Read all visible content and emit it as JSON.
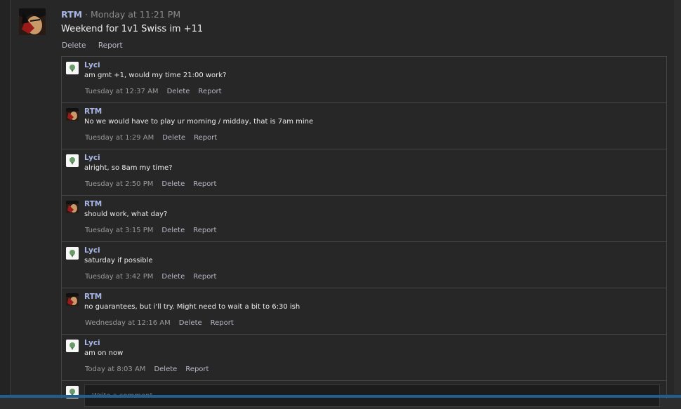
{
  "post": {
    "author": "RTM",
    "time": " · Monday at 11:21 PM",
    "body": "Weekend for 1v1 Swiss im +11",
    "delete_label": "Delete",
    "report_label": "Report"
  },
  "replies": [
    {
      "author": "Lyci",
      "text": "am gmt +1, would my time 21:00 work?",
      "time": "Tuesday at 12:37 AM",
      "delete_label": "Delete",
      "report_label": "Report"
    },
    {
      "author": "RTM",
      "text": "No we would have to play ur morning / midday, that is 7am mine",
      "time": "Tuesday at 1:29 AM",
      "delete_label": "Delete",
      "report_label": "Report"
    },
    {
      "author": "Lyci",
      "text": "alright, so 8am my time?",
      "time": "Tuesday at 2:50 PM",
      "delete_label": "Delete",
      "report_label": "Report"
    },
    {
      "author": "RTM",
      "text": "should work, what day?",
      "time": "Tuesday at 3:15 PM",
      "delete_label": "Delete",
      "report_label": "Report"
    },
    {
      "author": "Lyci",
      "text": "saturday if possible",
      "time": "Tuesday at 3:42 PM",
      "delete_label": "Delete",
      "report_label": "Report"
    },
    {
      "author": "RTM",
      "text": "no guarantees, but i'll try. Might need to wait a bit to 6:30 ish",
      "time": "Wednesday at 12:16 AM",
      "delete_label": "Delete",
      "report_label": "Report"
    },
    {
      "author": "Lyci",
      "text": "am on now",
      "time": "Today at 8:03 AM",
      "delete_label": "Delete",
      "report_label": "Report"
    }
  ],
  "compose": {
    "placeholder": "Write a comment..."
  },
  "colors": {
    "accent_name": "#a9b7e6",
    "background": "#272727",
    "bottom_bar": "#1f5f8f"
  }
}
